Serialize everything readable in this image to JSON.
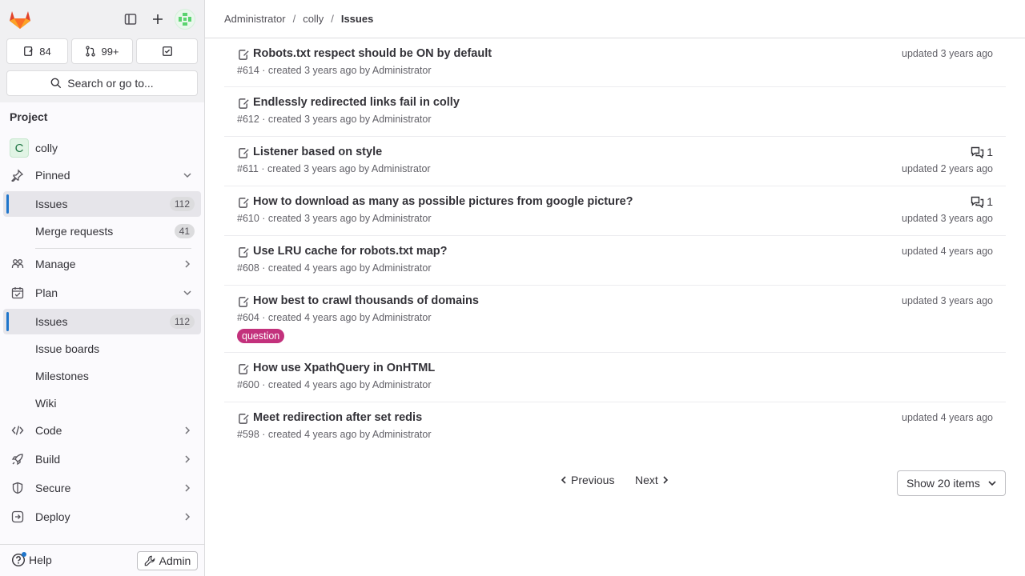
{
  "sidebar": {
    "counters": {
      "issues": "84",
      "merge_requests": "99+"
    },
    "search_label": "Search or go to...",
    "section_title": "Project",
    "project": {
      "initial": "C",
      "name": "colly"
    },
    "pinned": {
      "label": "Pinned",
      "items": [
        {
          "label": "Issues",
          "count": "112"
        },
        {
          "label": "Merge requests",
          "count": "41"
        }
      ]
    },
    "manage": "Manage",
    "plan": {
      "label": "Plan",
      "items": [
        {
          "label": "Issues",
          "count": "112"
        },
        {
          "label": "Issue boards"
        },
        {
          "label": "Milestones"
        },
        {
          "label": "Wiki"
        }
      ]
    },
    "code": "Code",
    "build": "Build",
    "secure": "Secure",
    "deploy": "Deploy",
    "help": "Help",
    "admin": "Admin"
  },
  "breadcrumb": [
    "Administrator",
    "colly",
    "Issues"
  ],
  "issues": [
    {
      "title": "Robots.txt respect should be ON by default",
      "meta": "#614 · created 3 years ago by Administrator",
      "updated": "updated 3 years ago",
      "comments": ""
    },
    {
      "title": "Endlessly redirected links fail in colly",
      "meta": "#612 · created 3 years ago by Administrator",
      "updated": "",
      "comments": ""
    },
    {
      "title": "Listener based on style",
      "meta": "#611 · created 3 years ago by Administrator",
      "updated": "updated 2 years ago",
      "comments": "1"
    },
    {
      "title": "How to download as many as possible pictures from google picture?",
      "meta": "#610 · created 3 years ago by Administrator",
      "updated": "updated 3 years ago",
      "comments": "1"
    },
    {
      "title": "Use LRU cache for robots.txt map?",
      "meta": "#608 · created 4 years ago by Administrator",
      "updated": "updated 4 years ago",
      "comments": ""
    },
    {
      "title": "How best to crawl thousands of domains",
      "meta": "#604 · created 4 years ago by Administrator",
      "updated": "updated 3 years ago",
      "comments": "",
      "label": "question"
    },
    {
      "title": "How use XpathQuery in OnHTML",
      "meta": "#600 · created 4 years ago by Administrator",
      "updated": "",
      "comments": ""
    },
    {
      "title": "Meet redirection after set redis",
      "meta": "#598 · created 4 years ago by Administrator",
      "updated": "updated 4 years ago",
      "comments": ""
    }
  ],
  "pagination": {
    "previous": "Previous",
    "next": "Next",
    "page_size": "Show 20 items"
  },
  "colors": {
    "accent": "#1f75cb",
    "label_question": "#c3317c"
  }
}
